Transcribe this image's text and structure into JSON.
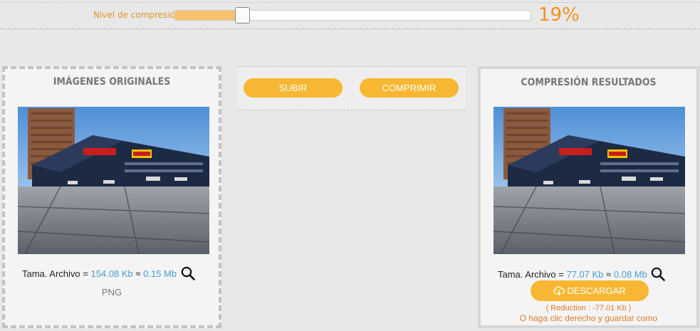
{
  "compression": {
    "label": "Nivel de compresión",
    "percent_text": "19%",
    "level": 0.19
  },
  "original": {
    "title": "IMÁGENES ORIGINALES",
    "size_prefix": "Tama. Archivo = ",
    "size_kb": "154.08 Kb",
    "approx": " ≈ ",
    "size_mb": "0.15 Mb",
    "type": "PNG"
  },
  "buttons": {
    "upload": "SUBIR",
    "compress": "COMPRIMIR"
  },
  "result": {
    "title": "COMPRESIÓN RESULTADOS",
    "size_prefix": "Tama. Archivo = ",
    "size_kb": "77.07 Kb",
    "approx": " ≈ ",
    "size_mb": "0.08 Mb",
    "download": "DESCARGAR",
    "reduction": "( Reduction : -77.01 Kb )",
    "hint": "O haga clic derecho y guardar como"
  },
  "colors": {
    "accent": "#f8b732",
    "accent_text": "#f0921a",
    "link_blue": "#4a9ad8"
  },
  "icons": [
    "magnifier-icon",
    "cloud-download-icon"
  ]
}
